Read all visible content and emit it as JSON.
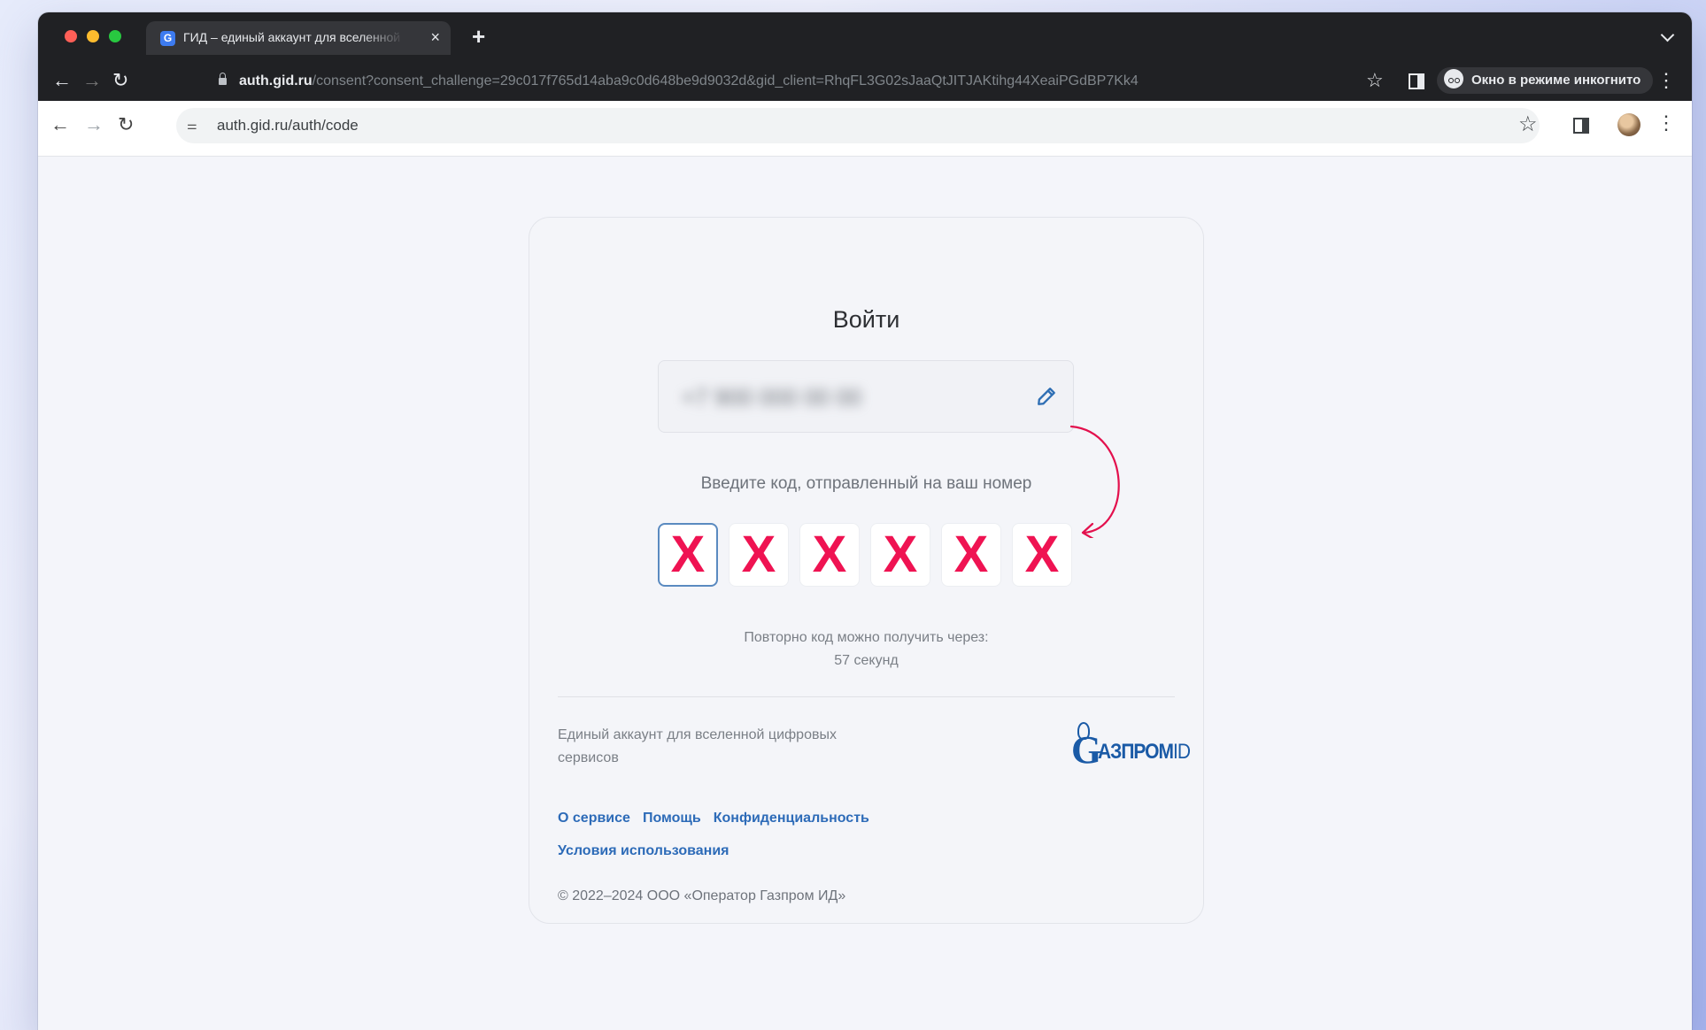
{
  "browser": {
    "tab_title": "ГИД – единый аккаунт для вселенной цифровых сервисов",
    "tab_favicon": "G",
    "new_tab": "+",
    "close": "×",
    "incognito_url_host": "auth.gid.ru",
    "incognito_url_path": "/consent?consent_challenge=29c017f765d14aba9c0d648be9d9032d&gid_client=RhqFL3G02sJaaQtJITJAKtihg44XeaiPGdBP7Kk4",
    "incognito_label": "Окно в режиме инкогнито",
    "address": "auth.gid.ru/auth/code"
  },
  "icons": {
    "back": "←",
    "forward": "→",
    "reload": "↻",
    "star": "☆",
    "menu": "⋮",
    "settings": "⚌"
  },
  "login": {
    "title": "Войти",
    "phone_value": "+7 900 000 00 00",
    "hint": "Введите код, отправленный на ваш номер",
    "code_digits": [
      "X",
      "X",
      "X",
      "X",
      "X",
      "X"
    ],
    "resend_label": "Повторно код можно получить через:",
    "resend_time": "57 секунд"
  },
  "footer": {
    "tagline": "Единый аккаунт для вселенной цифровых сервисов",
    "logo_g": "G",
    "logo_text": "АЗПРОМ",
    "logo_id": "ID",
    "links": [
      "О сервисе",
      "Помощь",
      "Конфиденциальность",
      "Условия использования"
    ],
    "copyright": "© 2022–2024 ООО «Оператор Газпром ИД»"
  },
  "colors": {
    "accent_red": "#ef1352",
    "link_blue": "#2d6bb8",
    "logo_blue": "#1a5aa6",
    "active_border": "#5a8ac0"
  }
}
